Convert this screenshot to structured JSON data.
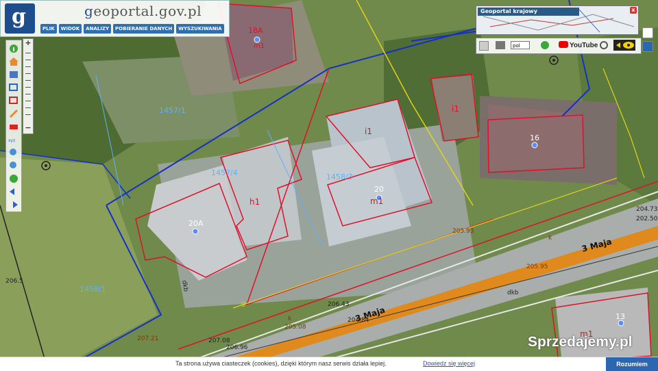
{
  "app": {
    "site_title_prefix": "g",
    "site_title_rest": "eoportal.gov.pl",
    "logo_letter": "g"
  },
  "menu": [
    "PLIK",
    "WIDOK",
    "ANALIZY",
    "POBIERANIE DANYCH",
    "WYSZUKIWANIA"
  ],
  "overview": {
    "title": "Geoportal krajowy",
    "close": "x"
  },
  "right_toolbar": {
    "language": "pol",
    "youtube": "YouTube"
  },
  "map": {
    "parcels": [
      "1457/1",
      "1457/4",
      "1458/3",
      "1458/1"
    ],
    "building_numbers": [
      "18A",
      "20A",
      "20",
      "16",
      "13"
    ],
    "building_codes": [
      "h1",
      "i1",
      "i1",
      "m1",
      "m1",
      "m1"
    ],
    "streets": [
      "3 Maja",
      "3 Maja"
    ],
    "elevations": [
      "206.43",
      "204.84",
      "205.08",
      "205.93",
      "204.73",
      "202.50",
      "205.95",
      "207.08",
      "207.21",
      "206.96",
      "206.5"
    ],
    "utility_labels": [
      "dkb",
      "dkb",
      "k",
      "k",
      "g"
    ]
  },
  "cookie": {
    "message": "Ta strona używa ciasteczek (cookies), dzięki którym nasz serwis działa lepiej.",
    "link": "Dowiedz się więcej",
    "button": "Rozumiem"
  },
  "watermark": {
    "text": "Sprzedajemy.pl"
  },
  "colors": {
    "brand_blue": "#1d4d8c",
    "parcel_red": "#e0102a",
    "parcel_blue": "#1530c8",
    "road_orange": "#e08a1e"
  }
}
